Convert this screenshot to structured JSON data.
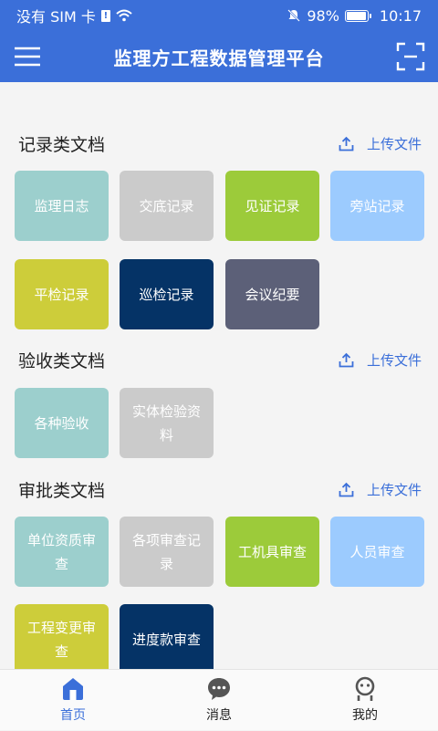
{
  "status_bar": {
    "carrier": "没有 SIM 卡",
    "sim_glyph": "!",
    "battery": "98%",
    "battery_level": 0.98,
    "time": "10:17"
  },
  "app_bar": {
    "title": "监理方工程数据管理平台",
    "left_icon": "menu-icon",
    "right_icon": "scan-icon"
  },
  "colors": {
    "primary": "#3b6fd9",
    "teal": "#9ccfcd",
    "gray": "#cbcbcb",
    "green": "#9ccb3a",
    "light_blue": "#9ccbfe",
    "olive": "#cdcd3a",
    "navy": "#053366",
    "slate": "#5c6078"
  },
  "sections": [
    {
      "title": "记录类文档",
      "upload_label": "上传文件",
      "tiles": [
        {
          "label": "监理日志",
          "color": "#9ccfcd"
        },
        {
          "label": "交底记录",
          "color": "#cbcbcb"
        },
        {
          "label": "见证记录",
          "color": "#9ccb3a"
        },
        {
          "label": "旁站记录",
          "color": "#9ccbfe"
        },
        {
          "label": "平检记录",
          "color": "#cdcd3a"
        },
        {
          "label": "巡检记录",
          "color": "#053366"
        },
        {
          "label": "会议纪要",
          "color": "#5c6078"
        }
      ]
    },
    {
      "title": "验收类文档",
      "upload_label": "上传文件",
      "tiles": [
        {
          "label": "各种验收",
          "color": "#9ccfcd"
        },
        {
          "label": "实体检验资料",
          "color": "#cbcbcb"
        }
      ]
    },
    {
      "title": "审批类文档",
      "upload_label": "上传文件",
      "tiles": [
        {
          "label": "单位资质审查",
          "color": "#9ccfcd"
        },
        {
          "label": "各项审查记录",
          "color": "#cbcbcb"
        },
        {
          "label": "工机具审查",
          "color": "#9ccb3a"
        },
        {
          "label": "人员审查",
          "color": "#9ccbfe"
        },
        {
          "label": "工程变更审查",
          "color": "#cdcd3a"
        },
        {
          "label": "进度款审查",
          "color": "#053366"
        }
      ]
    }
  ],
  "bottom_nav": [
    {
      "label": "首页",
      "icon": "home-icon",
      "active": true
    },
    {
      "label": "消息",
      "icon": "chat-icon",
      "active": false
    },
    {
      "label": "我的",
      "icon": "profile-icon",
      "active": false
    }
  ]
}
